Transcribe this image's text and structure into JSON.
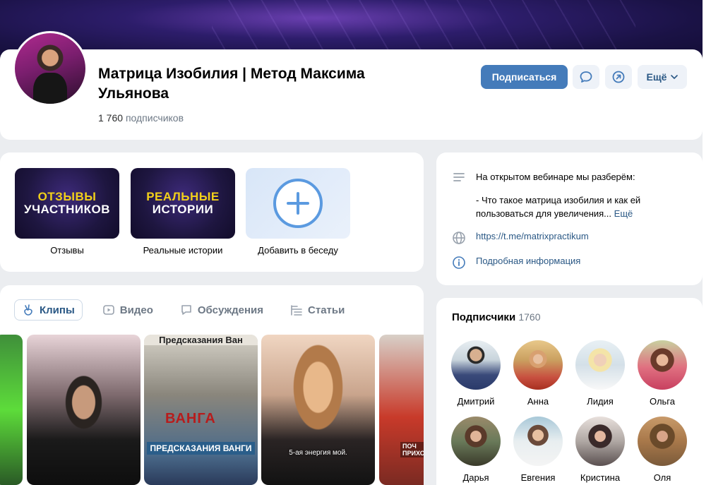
{
  "group": {
    "title": "Матрица Изобилия | Метод Максима Ульянова",
    "subscribers_count": "1 760",
    "subscribers_label": "подписчиков"
  },
  "actions": {
    "subscribe_label": "Подписаться",
    "more_label": "Ещё"
  },
  "chats": [
    {
      "label": "Отзывы",
      "thumb_line1": "ОТЗЫВЫ",
      "thumb_line2": "УЧАСТНИКОВ"
    },
    {
      "label": "Реальные истории",
      "thumb_line1": "РЕАЛЬНЫЕ",
      "thumb_line2": "ИСТОРИИ"
    },
    {
      "label": "Добавить в беседу"
    }
  ],
  "info": {
    "description_line1": "На открытом вебинаре мы разберём:",
    "description_line2": "- Что такое матрица изобилия и как ей пользоваться для увеличения...",
    "description_more": "Ещё",
    "link": "https://t.me/matrixpractikum",
    "details_label": "Подробная информация"
  },
  "tabs": [
    {
      "label": "Клипы",
      "icon": "clip-icon",
      "active": true
    },
    {
      "label": "Видео",
      "icon": "video-icon",
      "active": false
    },
    {
      "label": "Обсуждения",
      "icon": "discussion-icon",
      "active": false
    },
    {
      "label": "Статьи",
      "icon": "articles-icon",
      "active": false
    }
  ],
  "clips": {
    "vanga_top": "Предсказания Ван",
    "vanga_name": "ВАНГА",
    "vanga_banner": "ПРЕДСКАЗАНИЯ ВАНГИ",
    "caption_4": "5-ая энергия мой.",
    "side_text": "ПОЧ\nПРИХО"
  },
  "members": {
    "title": "Подписчики",
    "count": "1760",
    "items": [
      {
        "name": "Дмитрий"
      },
      {
        "name": "Анна"
      },
      {
        "name": "Лидия"
      },
      {
        "name": "Ольга"
      },
      {
        "name": "Дарья"
      },
      {
        "name": "Евгения"
      },
      {
        "name": "Кристина"
      },
      {
        "name": "Оля"
      }
    ]
  },
  "colors": {
    "accent": "#447bba",
    "link": "#2a5885",
    "secondary_text": "#6d7885",
    "page_bg": "#ebedf0"
  }
}
